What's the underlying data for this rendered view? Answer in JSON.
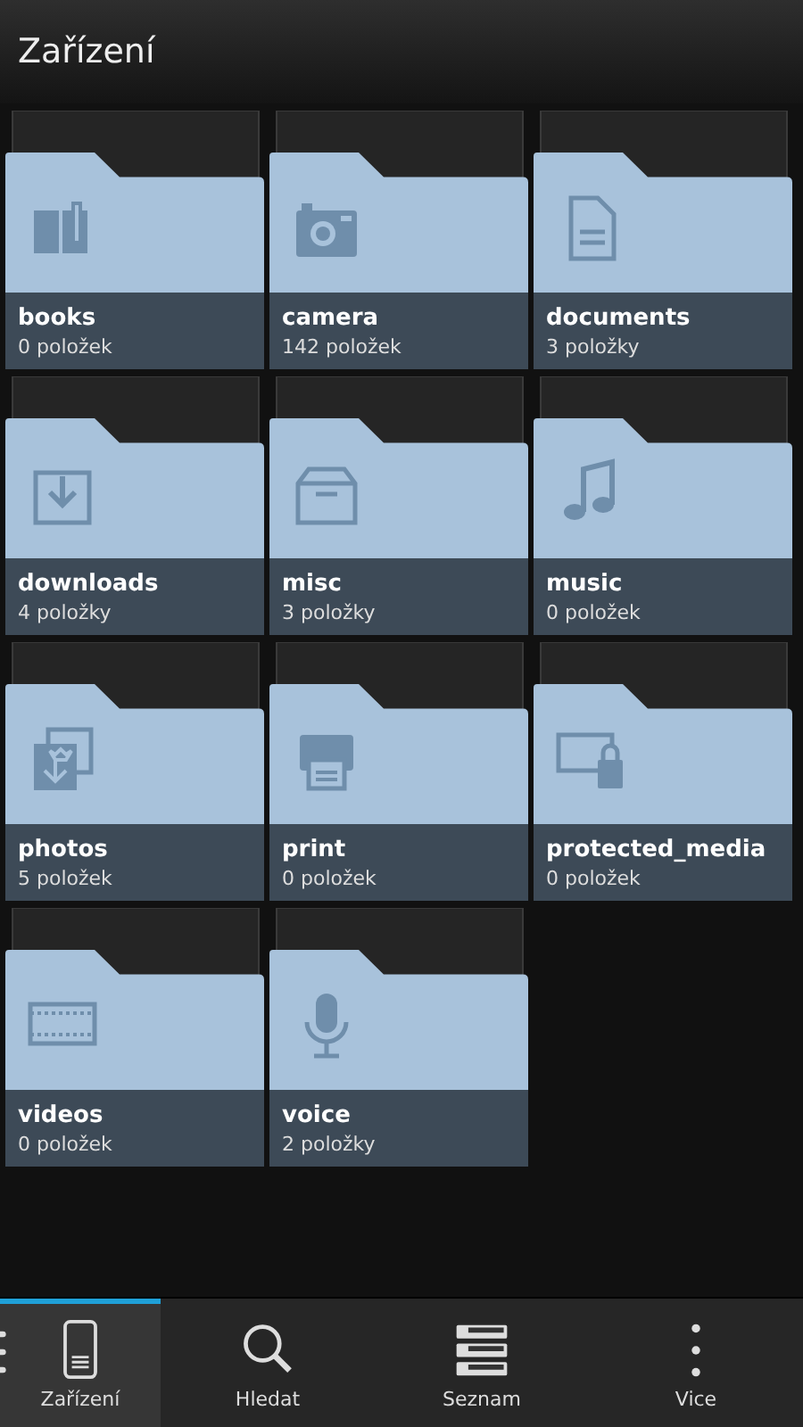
{
  "header": {
    "title": "Zařízení"
  },
  "folders": [
    {
      "name": "books",
      "count": "0 položek"
    },
    {
      "name": "camera",
      "count": "142 položek"
    },
    {
      "name": "documents",
      "count": "3 položky"
    },
    {
      "name": "downloads",
      "count": "4 položky"
    },
    {
      "name": "misc",
      "count": "3 položky"
    },
    {
      "name": "music",
      "count": "0 položek"
    },
    {
      "name": "photos",
      "count": "5 položek"
    },
    {
      "name": "print",
      "count": "0 položek"
    },
    {
      "name": "protected_media",
      "count": "0 položek"
    },
    {
      "name": "videos",
      "count": "0 položek"
    },
    {
      "name": "voice",
      "count": "2 položky"
    }
  ],
  "tabs": [
    {
      "label": "Zařízení",
      "selected": true
    },
    {
      "label": "Hledat",
      "selected": false
    },
    {
      "label": "Seznam",
      "selected": false
    },
    {
      "label": "Vice",
      "selected": false
    }
  ]
}
